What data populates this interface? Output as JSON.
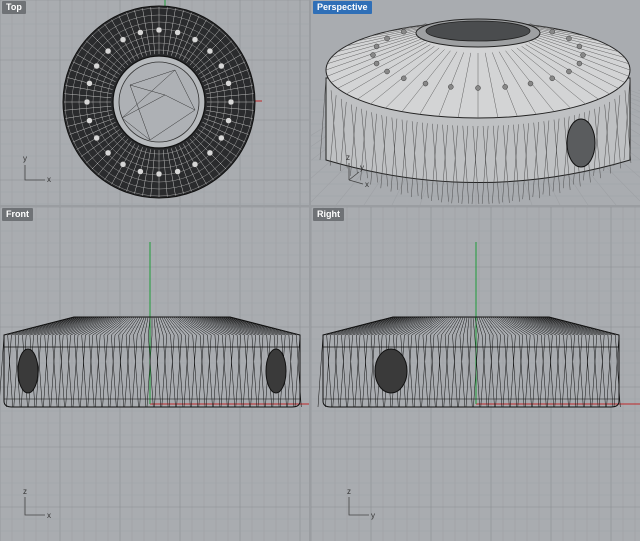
{
  "viewports": [
    {
      "id": "top",
      "label": "Top",
      "active": false,
      "axis_v": "y",
      "axis_h": "x"
    },
    {
      "id": "perspective",
      "label": "Perspective",
      "active": true,
      "axis_v": "z",
      "axis_h": "x",
      "axis_d": "y"
    },
    {
      "id": "front",
      "label": "Front",
      "active": false,
      "axis_v": "z",
      "axis_h": "x"
    },
    {
      "id": "right",
      "label": "Right",
      "active": false,
      "axis_v": "z",
      "axis_h": "y"
    }
  ],
  "colors": {
    "grid_bg": "#a9acb0",
    "grid_minor": "#9ea1a5",
    "grid_major": "#8c8f93",
    "x_axis": "#c0282a",
    "y_axis": "#1f9d3a",
    "active_label": "#2f6fb7",
    "inactive_label": "#6f7276"
  }
}
